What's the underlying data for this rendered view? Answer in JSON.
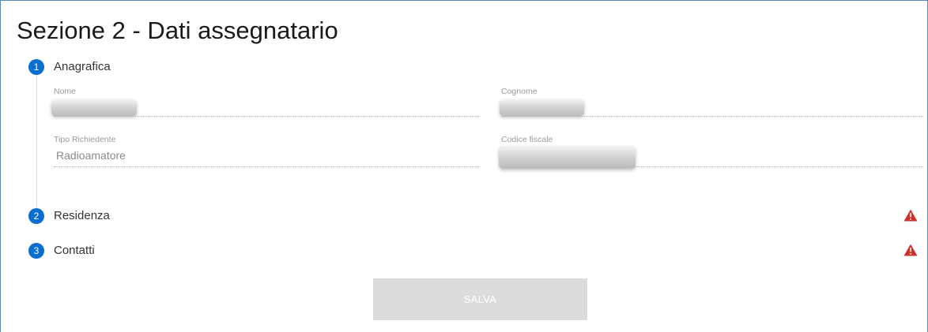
{
  "section": {
    "title": "Sezione 2 - Dati assegnatario"
  },
  "steps": [
    {
      "number": "1",
      "label": "Anagrafica"
    },
    {
      "number": "2",
      "label": "Residenza",
      "status_icon": "warning-triangle-icon"
    },
    {
      "number": "3",
      "label": "Contatti",
      "status_icon": "warning-triangle-icon"
    }
  ],
  "anagrafica": {
    "nome": {
      "label": "Nome",
      "value": ""
    },
    "cognome": {
      "label": "Cognome",
      "value": ""
    },
    "tipo_richiedente": {
      "label": "Tipo Richiedente",
      "value": "Radioamatore"
    },
    "codice_fiscale": {
      "label": "Codice fiscale",
      "value": ""
    }
  },
  "actions": {
    "save_label": "SALVA",
    "save_enabled": false
  },
  "colors": {
    "step_accent": "#0a6ecf",
    "warning": "#d0312d",
    "panel_border": "#5c87b2",
    "disabled_button": "#dcdcdc"
  }
}
